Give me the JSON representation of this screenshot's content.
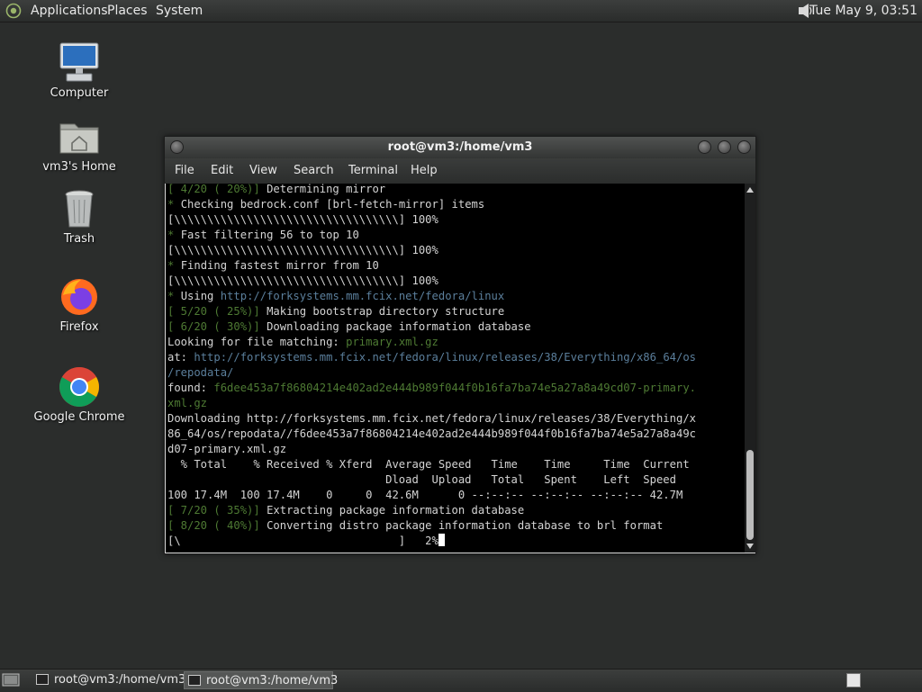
{
  "top_panel": {
    "menus": [
      "Applications",
      "Places",
      "System"
    ],
    "clock": "Tue May  9, 03:51",
    "logo_icon": "gnome-foot-icon",
    "volume_icon": "speaker-icon"
  },
  "desktop": {
    "icons": [
      {
        "label": "Computer",
        "icon": "computer-icon"
      },
      {
        "label": "vm3's Home",
        "icon": "home-folder-icon"
      },
      {
        "label": "Trash",
        "icon": "trash-icon"
      },
      {
        "label": "Firefox",
        "icon": "firefox-icon"
      },
      {
        "label": "Google Chrome",
        "icon": "chrome-icon"
      }
    ]
  },
  "terminal": {
    "title": "root@vm3:/home/vm3",
    "menu": [
      "File",
      "Edit",
      "View",
      "Search",
      "Terminal",
      "Help"
    ],
    "lines": [
      [
        {
          "t": "[ 4/20 ( 20%)] ",
          "c": "g"
        },
        {
          "t": "Determining mirror"
        }
      ],
      [
        {
          "t": "* ",
          "c": "g"
        },
        {
          "t": "Checking bedrock.conf [brl-fetch-mirror] items"
        }
      ],
      [
        {
          "t": "[\\\\\\\\\\\\\\\\\\\\\\\\\\\\\\\\\\\\\\\\\\\\\\\\\\\\\\\\\\\\\\\\\\\\] 100%"
        }
      ],
      [
        {
          "t": "* ",
          "c": "g"
        },
        {
          "t": "Fast filtering 56 to top 10"
        }
      ],
      [
        {
          "t": "[\\\\\\\\\\\\\\\\\\\\\\\\\\\\\\\\\\\\\\\\\\\\\\\\\\\\\\\\\\\\\\\\\\\\] 100%"
        }
      ],
      [
        {
          "t": "* ",
          "c": "g"
        },
        {
          "t": "Finding fastest mirror from 10"
        }
      ],
      [
        {
          "t": "[\\\\\\\\\\\\\\\\\\\\\\\\\\\\\\\\\\\\\\\\\\\\\\\\\\\\\\\\\\\\\\\\\\\\] 100%"
        }
      ],
      [
        {
          "t": "* ",
          "c": "g"
        },
        {
          "t": "Using "
        },
        {
          "t": "http://forksystems.mm.fcix.net/fedora/linux",
          "c": "u"
        }
      ],
      [
        {
          "t": "[ 5/20 ( 25%)] ",
          "c": "g"
        },
        {
          "t": "Making bootstrap directory structure"
        }
      ],
      [
        {
          "t": "[ 6/20 ( 30%)] ",
          "c": "g"
        },
        {
          "t": "Downloading package information database"
        }
      ],
      [
        {
          "t": "Looking for file matching: "
        },
        {
          "t": "primary.xml.gz",
          "c": "g"
        }
      ],
      [
        {
          "t": "at: "
        },
        {
          "t": "http://forksystems.mm.fcix.net/fedora/linux/releases/38/Everything/x86_64/os",
          "c": "u"
        }
      ],
      [
        {
          "t": "/repodata/",
          "c": "u"
        }
      ],
      [
        {
          "t": "found: "
        },
        {
          "t": "f6dee453a7f86804214e402ad2e444b989f044f0b16fa7ba74e5a27a8a49cd07-primary.",
          "c": "g"
        }
      ],
      [
        {
          "t": "xml.gz",
          "c": "g"
        }
      ],
      [
        {
          "t": "Downloading http://forksystems.mm.fcix.net/fedora/linux/releases/38/Everything/x"
        }
      ],
      [
        {
          "t": "86_64/os/repodata//f6dee453a7f86804214e402ad2e444b989f044f0b16fa7ba74e5a27a8a49c"
        }
      ],
      [
        {
          "t": "d07-primary.xml.gz"
        }
      ],
      [
        {
          "t": "  % Total    % Received % Xferd  Average Speed   Time    Time     Time  Current"
        }
      ],
      [
        {
          "t": "                                 Dload  Upload   Total   Spent    Left  Speed"
        }
      ],
      [
        {
          "t": "100 17.4M  100 17.4M    0     0  42.6M      0 --:--:-- --:--:-- --:--:-- 42.7M"
        }
      ],
      [
        {
          "t": "[ 7/20 ( 35%)] ",
          "c": "g"
        },
        {
          "t": "Extracting package information database"
        }
      ],
      [
        {
          "t": "[ 8/20 ( 40%)] ",
          "c": "g"
        },
        {
          "t": "Converting distro package information database to brl format"
        }
      ],
      [
        {
          "t": "[\\                                 ]   2%"
        }
      ]
    ]
  },
  "taskbar": {
    "tasks": [
      {
        "label": "root@vm3:/home/vm3",
        "active": false
      },
      {
        "label": "root@vm3:/home/vm3",
        "active": true
      }
    ]
  }
}
